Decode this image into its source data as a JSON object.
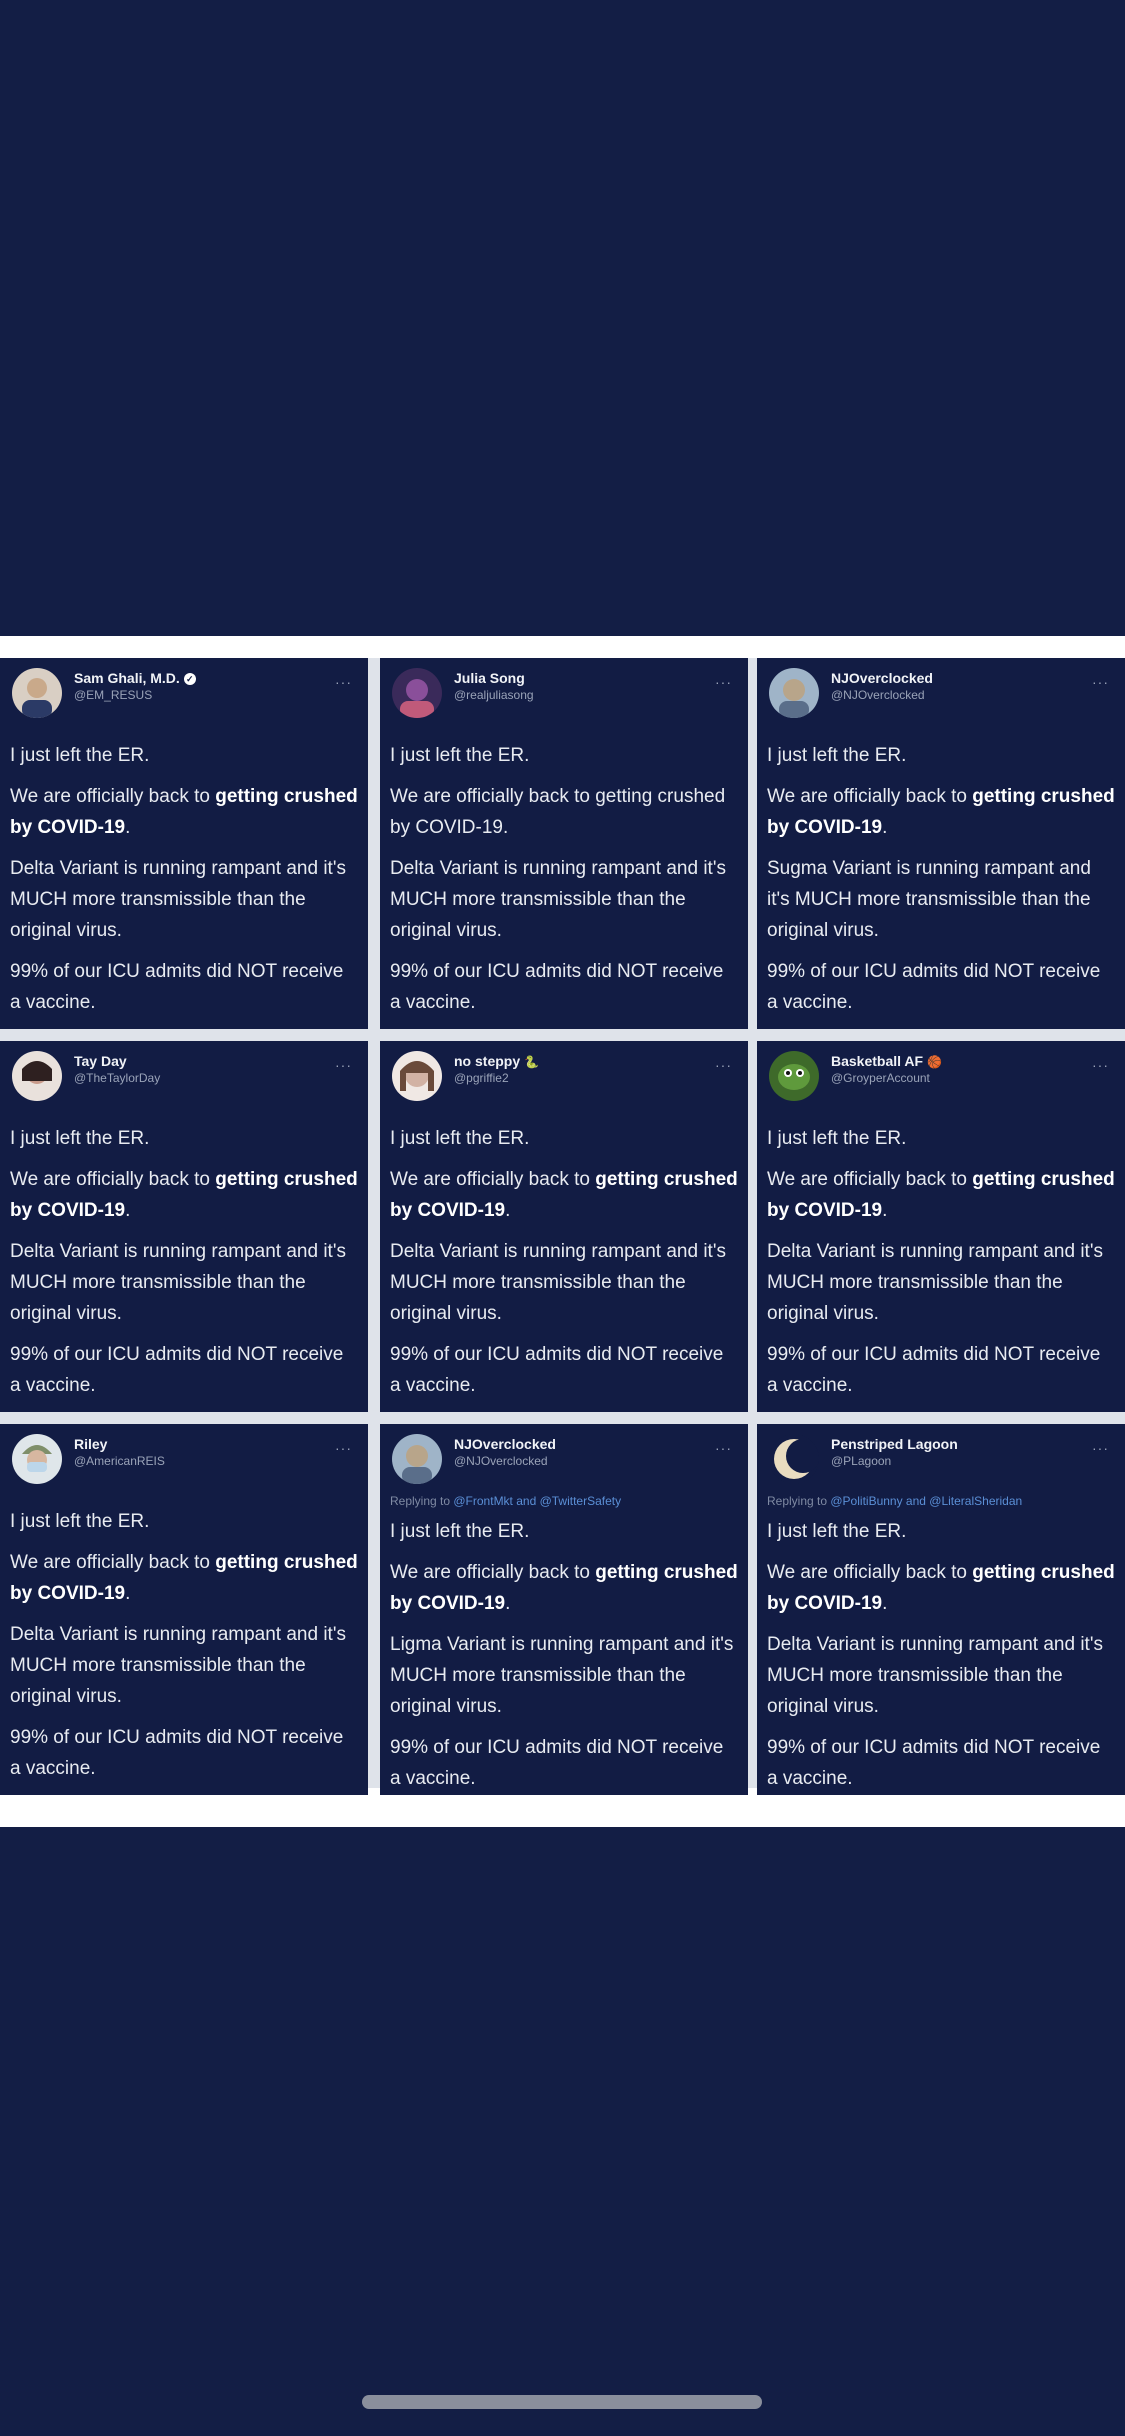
{
  "tweets": [
    {
      "display_name": "Sam Ghali, M.D.",
      "handle": "@EM_RESUS",
      "verified": true,
      "avatar_color": "#c9a98a",
      "line1": "I just left the ER.",
      "line2_start": "We are officially back to ",
      "line2_bold": "getting crushed by COVID-19",
      "line2_end": ".",
      "line3": "Delta Variant is running rampant and it's MUCH more transmissible than the original virus.",
      "line4": "99% of our ICU admits did NOT receive a vaccine."
    },
    {
      "display_name": "Julia Song",
      "handle": "@realjuliasong",
      "avatar_color": "#8a4f9a",
      "line1": "I just left the ER.",
      "line2_start": "We are officially back to getting crushed by COVID-19.",
      "line3": "Delta Variant is running rampant and it's MUCH more transmissible than the original virus.",
      "line4": "99% of our ICU admits did NOT receive a vaccine."
    },
    {
      "display_name": "NJOverclocked",
      "handle": "@NJOverclocked",
      "avatar_color": "#b8a58a",
      "line1": "I just left the ER.",
      "line2_start": "We are officially back to ",
      "line2_bold": "getting crushed by COVID-19",
      "line2_end": ".",
      "line3": "Sugma Variant is running rampant and it's MUCH more transmissible than the original virus.",
      "line4": "99% of our ICU admits did NOT receive a vaccine."
    },
    {
      "display_name": "Tay Day",
      "handle": "@TheTaylorDay",
      "avatar_color": "#c89a8a",
      "line1": "I just left the ER.",
      "line2_start": "We are officially back to ",
      "line2_bold": "getting crushed by COVID-19",
      "line2_end": ".",
      "line3": "Delta Variant is running rampant and it's MUCH more transmissible than the original virus.",
      "line4": "99% of our ICU admits did NOT receive a vaccine."
    },
    {
      "display_name": "no steppy",
      "handle": "@pgriffie2",
      "badge": "🐍",
      "avatar_color": "#d2b2a4",
      "line1": "I just left the ER.",
      "line2_start": "We are officially back to ",
      "line2_bold": "getting crushed by COVID-19",
      "line2_end": ".",
      "line3": "Delta Variant is running rampant and it's MUCH more transmissible than the original virus.",
      "line4": "99% of our ICU admits did NOT receive a vaccine."
    },
    {
      "display_name": "Basketball AF",
      "handle": "@GroyperAccount",
      "badge": "🏀",
      "avatar_color": "#5f9a3c",
      "line1": "I just left the ER.",
      "line2_start": "We are officially back to ",
      "line2_bold": "getting crushed by COVID-19",
      "line2_end": ".",
      "line3": "Delta Variant is running rampant and it's MUCH more transmissible than the original virus.",
      "line4": "99% of our ICU admits did NOT receive a vaccine."
    },
    {
      "display_name": "Riley",
      "handle": "@AmericanREIS",
      "avatar_color": "#7f8f6a",
      "line1": "I just left the ER.",
      "line2_start": "We are officially back to ",
      "line2_bold": "getting crushed by COVID-19",
      "line2_end": ".",
      "line3": "Delta Variant is running rampant and it's MUCH more transmissible than the original virus.",
      "line4": "99% of our ICU admits did NOT receive a vaccine."
    },
    {
      "display_name": "NJOverclocked",
      "handle": "@NJOverclocked",
      "avatar_color": "#b8a58a",
      "reply_prefix": "Replying to ",
      "reply_to": "@FrontMkt and @TwitterSafety",
      "line1": "I just left the ER.",
      "line2_start": "We are officially back to ",
      "line2_bold": "getting crushed by COVID-19",
      "line2_end": ".",
      "line3": "Ligma Variant is running rampant and it's MUCH more transmissible than the original virus.",
      "line4": "99% of our ICU admits did NOT receive a vaccine."
    },
    {
      "display_name": "Penstriped Lagoon",
      "handle": "@PLagoon",
      "avatar_color": "#e9dcc0",
      "reply_prefix": "Replying to ",
      "reply_to": "@PolitiBunny and @LiteralSheridan",
      "line1": "I just left the ER.",
      "line2_start": "We are officially back to ",
      "line2_bold": "getting crushed by COVID-19",
      "line2_end": ".",
      "line3": "Delta Variant is running rampant and it's MUCH more transmissible than the original virus.",
      "line4": "99% of our ICU admits did NOT receive a vaccine."
    }
  ]
}
